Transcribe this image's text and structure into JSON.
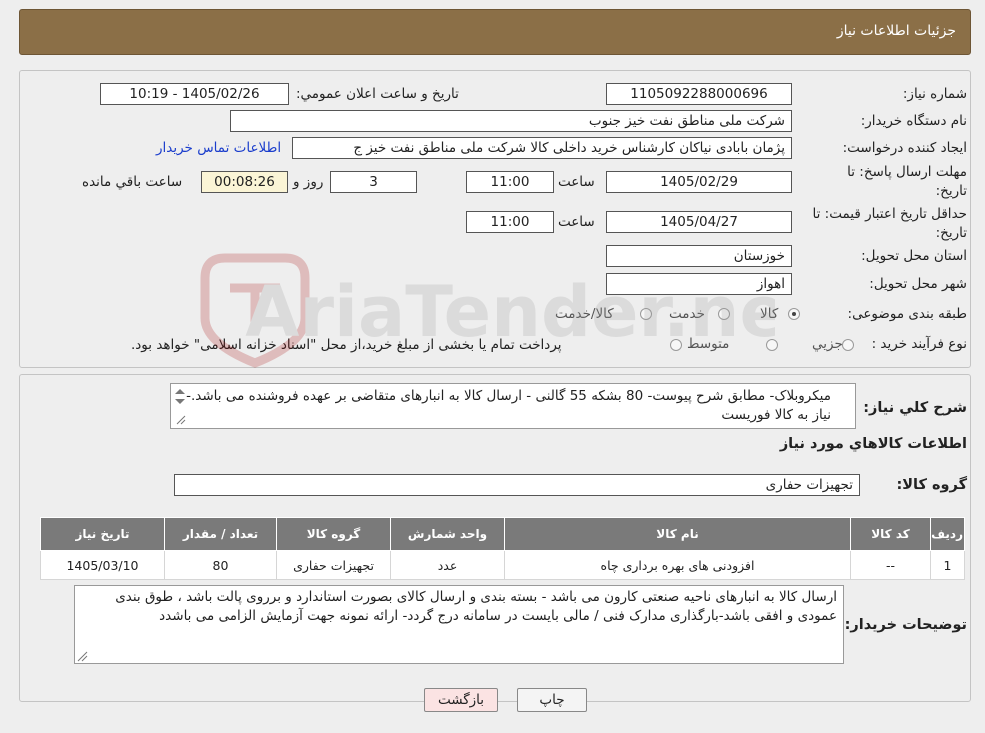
{
  "header": {
    "title": "جزئیات اطلاعات نیاز"
  },
  "form": {
    "need_number_label": "شماره نیاز:",
    "need_number": "1105092288000696",
    "announce_label": "تاریخ و ساعت اعلان عمومي:",
    "announce_value": "1405/02/26 - 10:19",
    "buyer_org_label": "نام دستگاه خريدار:",
    "buyer_org": "شرکت ملی مناطق نفت خیز جنوب",
    "requester_label": "ايجاد کننده درخواست:",
    "requester": "پژمان  بابادی نیاکان  کارشناس خرید داخلی کالا  شرکت ملی مناطق نفت خیز ج",
    "contact_link": "اطلاعات تماس خريدار",
    "deadline_label_1": "مهلت ارسال پاسخ: تا",
    "deadline_label_2": "تاريخ:",
    "deadline_date": "1405/02/29",
    "time_label": "ساعت",
    "deadline_time": "11:00",
    "days_value": "3",
    "days_label": "روز و",
    "remaining_time": "00:08:26",
    "remaining_label": "ساعت باقي مانده",
    "validity_label_1": "حداقل تاريخ اعتبار قيمت: تا",
    "validity_label_2": "تاريخ:",
    "validity_date": "1405/04/27",
    "validity_time": "11:00",
    "province_label": "استان محل تحويل:",
    "province": "خوزستان",
    "city_label": "شهر محل تحويل:",
    "city": "اهواز",
    "category_label": "طبقه بندی موضوعی:",
    "category_options": [
      "کالا",
      "خدمت",
      "کالا/خدمت"
    ],
    "category_selected": "کالا",
    "process_label": "نوع فرآيند خريد :",
    "process_options": [
      "جزيي",
      "متوسط"
    ],
    "process_note": "پرداخت تمام يا بخشی از مبلغ خريد،از محل \"اسناد خزانه اسلامی\" خواهد بود."
  },
  "description": {
    "label": "شرح كلي نياز:",
    "text": "میکروبلاک- مطابق شرح پیوست- 80 بشکه 55 گالنی - ارسال کالا به انبارهای متقاضی بر عهده فروشنده می باشد.- نیاز به کالا فوریست"
  },
  "goods": {
    "section_title": "اطلاعات کالاهاي مورد نياز",
    "group_label": "گروه کالا:",
    "group_value": "تجهیزات حفاری",
    "columns": [
      "رديف",
      "کد کالا",
      "نام کالا",
      "واحد شمارش",
      "گروه کالا",
      "تعداد / مقدار",
      "تاريخ نياز"
    ],
    "rows": [
      [
        "1",
        "--",
        "افزودنی های بهره برداری چاه",
        "عدد",
        "تجهیزات حفاری",
        "80",
        "1405/03/10"
      ]
    ]
  },
  "buyer_notes": {
    "label": "توضيحات خريدار:",
    "text": "ارسال کالا به انبارهای  ناحیه صنعتی  کارون می باشد  - بسته بندی و ارسال کالای بصورت استاندارد و برروی پالت باشد ، طوق بندی عمودی و افقی  باشد-بارگذاری مدارک فنی / مالی بایست در سامانه درج گردد- ارائه نمونه جهت آزمایش الزامی می باشدد"
  },
  "buttons": {
    "print": "چاپ",
    "back": "بازگشت"
  },
  "watermark": {
    "text": "AriaTender.neT"
  },
  "colors": {
    "header": "#8b6f47",
    "link": "#1a3dcc",
    "table_header": "#7a7a7a",
    "back_button": "#fbe3e3",
    "remaining_bg": "#fbf5d6"
  }
}
